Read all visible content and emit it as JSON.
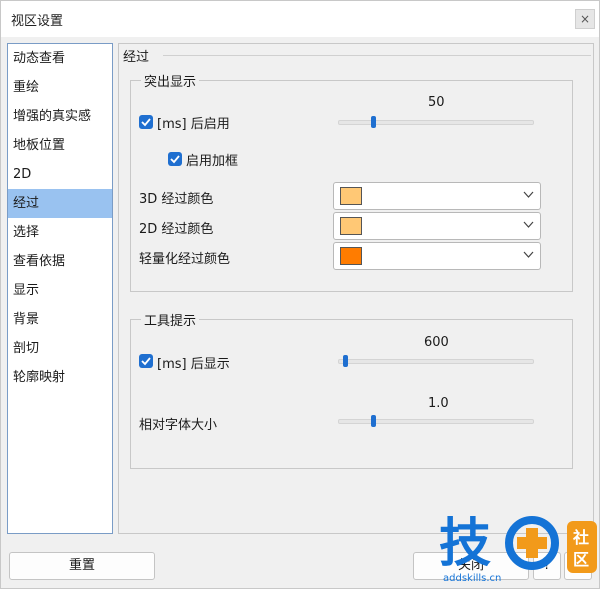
{
  "window": {
    "title": "视区设置",
    "close_glyph": "×"
  },
  "sidebar": {
    "items": [
      {
        "label": "动态查看"
      },
      {
        "label": "重绘"
      },
      {
        "label": "增强的真实感"
      },
      {
        "label": "地板位置"
      },
      {
        "label": "2D"
      },
      {
        "label": "经过",
        "active": true
      },
      {
        "label": "选择"
      },
      {
        "label": "查看依据"
      },
      {
        "label": "显示"
      },
      {
        "label": "背景"
      },
      {
        "label": "剖切"
      },
      {
        "label": "轮廓映射"
      }
    ]
  },
  "panel": {
    "title": "经过",
    "highlight_group": {
      "title": "突出显示",
      "enable_after_label": "[ms] 后启用",
      "enable_after_checked": true,
      "enable_after_value": "50",
      "enable_after_fraction": 0.17,
      "bbox_label": "启用加框",
      "bbox_checked": true,
      "color_3d_label": "3D 经过颜色",
      "color_3d": "#ffc875",
      "color_2d_label": "2D 经过颜色",
      "color_2d": "#ffc875",
      "color_light_label": "轻量化经过颜色",
      "color_light": "#ff7c00"
    },
    "tooltip_group": {
      "title": "工具提示",
      "show_after_label": "[ms] 后显示",
      "show_after_checked": true,
      "show_after_value": "600",
      "show_after_fraction": 0.02,
      "font_size_label": "相对字体大小",
      "font_size_value": "1.0",
      "font_size_fraction": 0.17
    }
  },
  "buttons": {
    "reset": "重置",
    "close": "关闭",
    "help_glyph": "?"
  },
  "watermark": {
    "main": "技",
    "side_top": "社",
    "side_bottom": "区",
    "url": "addskills.cn"
  },
  "colors": {
    "accent": "#1f6fd0",
    "selection": "#99c2f0",
    "watermark_blue": "#1473d6",
    "watermark_orange": "#f29a1a"
  }
}
